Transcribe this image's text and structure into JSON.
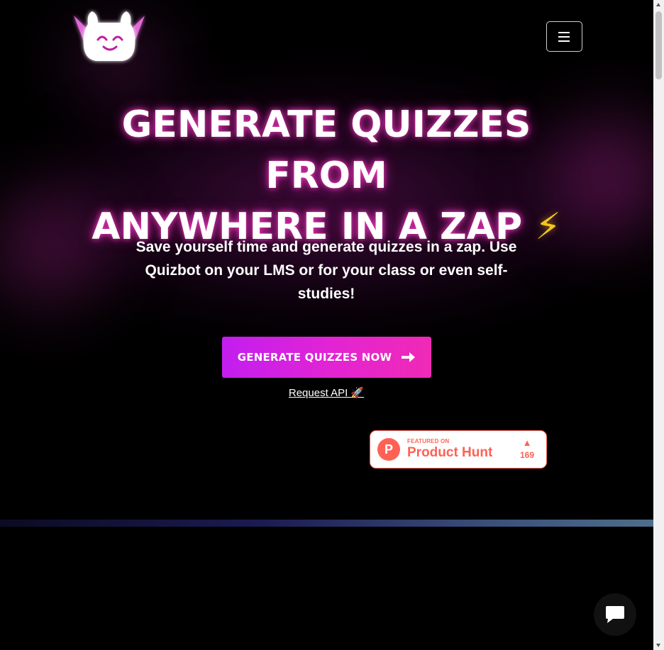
{
  "header": {
    "logo_icon": "quizbot-mascot-icon",
    "menu_icon": "hamburger-menu-icon"
  },
  "hero": {
    "headline_line1": "GENERATE QUIZZES FROM",
    "headline_line2": "ANYWHERE IN A ZAP",
    "headline_emoji": "⚡",
    "subtitle": "Save yourself time and generate quizzes in a zap. Use Quizbot on your LMS or for your class or even self-studies!",
    "cta_label": "GENERATE QUIZZES NOW",
    "cta_icon": "arrow-right-icon",
    "api_link": "Request API 🚀"
  },
  "product_hunt": {
    "featured_label": "FEATURED ON",
    "name": "Product Hunt",
    "logo_letter": "P",
    "upvote_icon": "▲",
    "votes": "169"
  },
  "chat": {
    "icon": "chat-bubble-icon"
  },
  "colors": {
    "background": "#000000",
    "cta_start": "#c21ef0",
    "cta_end": "#ef2ab5",
    "glow": "#e424d2",
    "product_hunt": "#ff6154",
    "zap": "#f5c518"
  }
}
